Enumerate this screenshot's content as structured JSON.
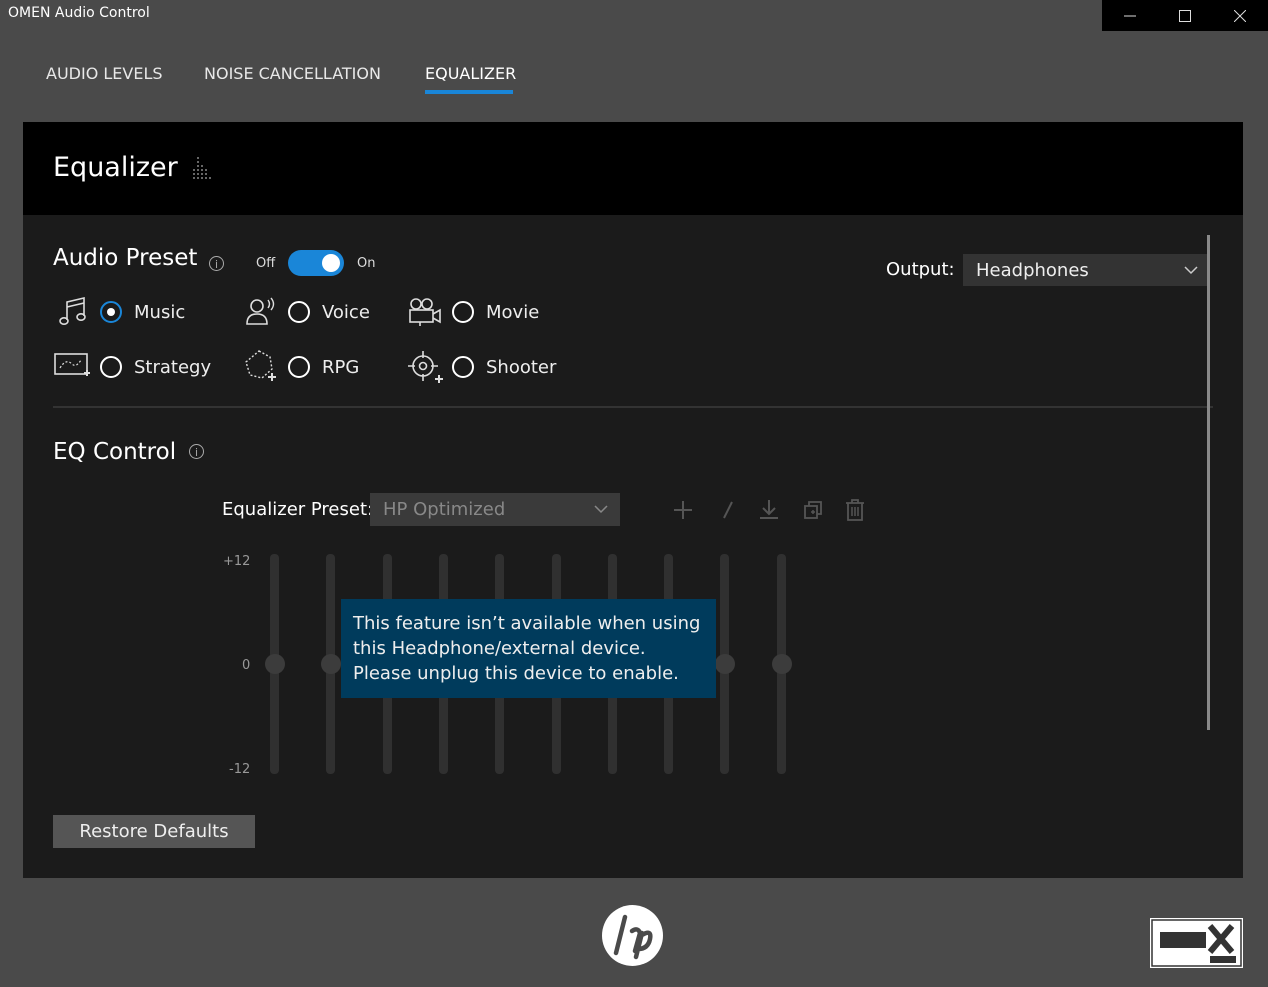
{
  "window": {
    "title": "OMEN Audio Control"
  },
  "tabs": [
    {
      "label": "AUDIO LEVELS"
    },
    {
      "label": "NOISE CANCELLATION"
    },
    {
      "label": "EQUALIZER",
      "active": true
    }
  ],
  "panel": {
    "title": "Equalizer"
  },
  "audio_preset": {
    "heading": "Audio Preset",
    "info": "i",
    "toggle_off_label": "Off",
    "toggle_on_label": "On",
    "toggle_state": "On",
    "options": [
      {
        "label": "Music",
        "icon": "music-note-icon",
        "selected": true
      },
      {
        "label": "Voice",
        "icon": "voice-person-icon",
        "selected": false
      },
      {
        "label": "Movie",
        "icon": "movie-camera-icon",
        "selected": false
      },
      {
        "label": "Strategy",
        "icon": "strategy-map-icon",
        "selected": false
      },
      {
        "label": "RPG",
        "icon": "rpg-icon",
        "selected": false
      },
      {
        "label": "Shooter",
        "icon": "crosshair-icon",
        "selected": false
      }
    ]
  },
  "output": {
    "label": "Output:",
    "value": "Headphones"
  },
  "eq_control": {
    "heading": "EQ Control",
    "info": "i",
    "preset_label": "Equalizer Preset:",
    "preset_value": "HP Optimized",
    "tools": [
      "add-icon",
      "edit-icon",
      "download-icon",
      "copy-icon",
      "delete-icon"
    ],
    "scale": {
      "top": "+12",
      "mid": "0",
      "bottom": "-12"
    },
    "band_levels_db": [
      0,
      0,
      0,
      0,
      0,
      0,
      0,
      0,
      0,
      0
    ],
    "tooltip": "This feature isn’t available when using this Headphone/external device. Please unplug this device to enable.",
    "restore_label": "Restore Defaults"
  },
  "colors": {
    "accent": "#1a86d8",
    "tooltip_bg": "#003b5c",
    "panel_bg": "#1b1b1b"
  }
}
